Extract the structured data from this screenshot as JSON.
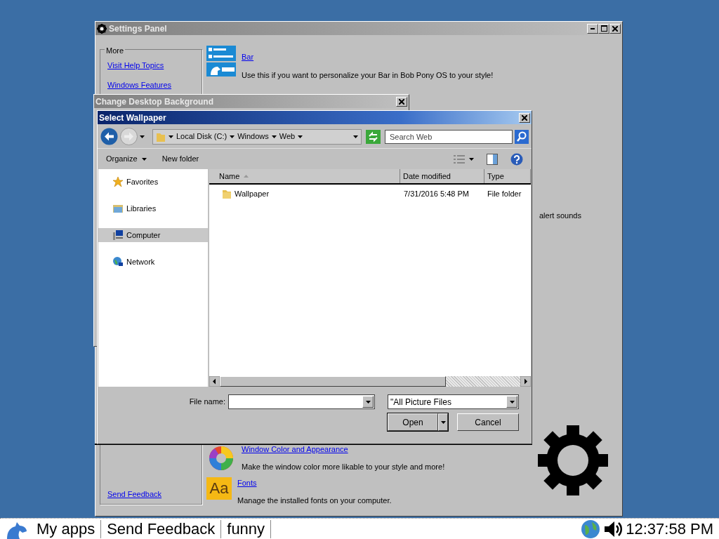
{
  "settings_window": {
    "title": "Settings Panel",
    "more_group": {
      "legend": "More",
      "links": [
        "Visit Help Topics",
        "Windows Features",
        "Send Feedback"
      ]
    },
    "items": [
      {
        "kind": "bar",
        "title": "Bar",
        "description": "Use this if you want to personalize your Bar in Bob Pony OS to your style!"
      },
      {
        "kind": "color",
        "title": "Window Color and Appearance",
        "description": "Make the window color more likable to your style and more!"
      },
      {
        "kind": "fonts",
        "icon_text": "Aa",
        "title": "Fonts",
        "description": "Manage the installed fonts on your computer."
      }
    ],
    "partial_text": "alert sounds"
  },
  "background_window": {
    "title": "Change Desktop Background"
  },
  "dialog": {
    "title": "Select Wallpaper",
    "breadcrumbs": [
      "Local Disk (C:)",
      "Windows",
      "Web"
    ],
    "search": {
      "placeholder": "Search Web"
    },
    "toolbar": [
      "Organize",
      "New folder"
    ],
    "nav": [
      {
        "kind": "star",
        "label": "Favorites",
        "selected": false
      },
      {
        "kind": "libraries",
        "label": "Libraries",
        "selected": false
      },
      {
        "kind": "computer",
        "label": "Computer",
        "selected": true
      },
      {
        "kind": "network",
        "label": "Network",
        "selected": false
      }
    ],
    "columns": [
      "Name",
      "Date modified",
      "Type"
    ],
    "files": [
      {
        "name": "Wallpaper",
        "date": "7/31/2016 5:48 PM",
        "type": "File folder"
      }
    ],
    "file_name": {
      "label": "File name:"
    },
    "filter": "\"All Picture Files",
    "buttons": [
      "Open",
      "Cancel"
    ]
  },
  "taskbar": {
    "items": [
      "My apps",
      "Send Feedback",
      "funny"
    ],
    "clock": "12:37:58 PM"
  }
}
